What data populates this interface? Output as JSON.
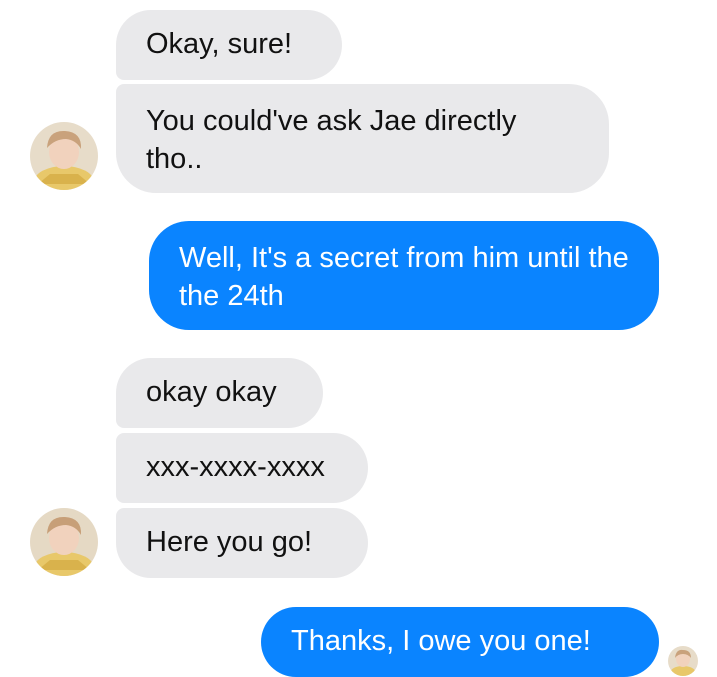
{
  "conversation": {
    "messages": [
      {
        "direction": "incoming",
        "text": "Okay, sure!"
      },
      {
        "direction": "incoming",
        "text": "You could've ask Jae directly tho.."
      },
      {
        "direction": "outgoing",
        "text": "Well, It's a secret from him until the the 24th"
      },
      {
        "direction": "incoming",
        "text": "okay okay"
      },
      {
        "direction": "incoming",
        "text": "xxx-xxxx-xxxx"
      },
      {
        "direction": "incoming",
        "text": "Here you go!"
      },
      {
        "direction": "outgoing",
        "text": "Thanks, I owe you one!"
      }
    ]
  },
  "avatars": {
    "contact_icon": "user-avatar-photo",
    "read_receipt_icon": "read-receipt-avatar"
  },
  "colors": {
    "incoming_bubble": "#e9e9eb",
    "outgoing_bubble": "#0a84ff",
    "incoming_text": "#111111",
    "outgoing_text": "#ffffff",
    "background": "#ffffff"
  }
}
